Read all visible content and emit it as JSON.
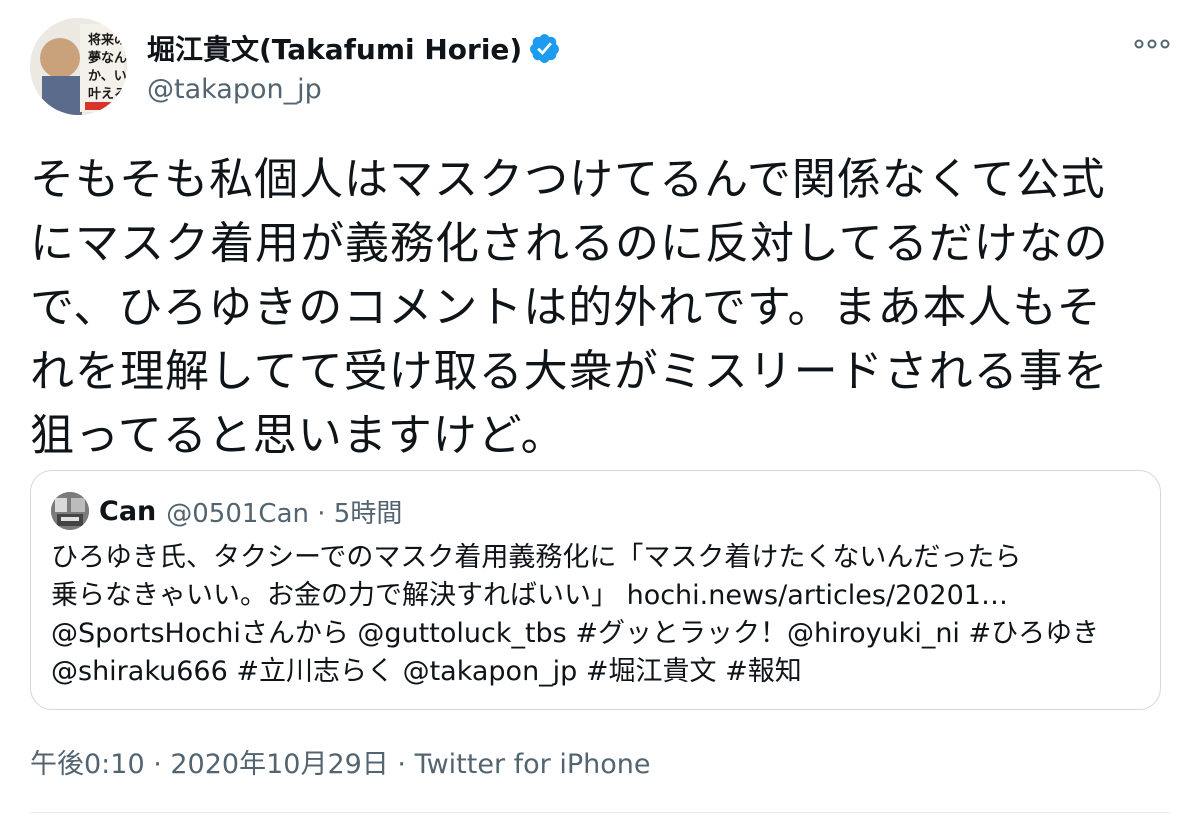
{
  "author": {
    "display_name": "堀江貴文(Takafumi Horie)",
    "handle": "@takapon_jp",
    "verified": true,
    "avatar_icon": "avatar-book-cover-icon",
    "avatar_text": "将来の夢なんか、いま叶えろ"
  },
  "menu": {
    "icon": "more-horizontal-icon"
  },
  "tweet": {
    "lines": [
      "そもそも私個人はマスクつけてるんで関係なくて公式",
      "にマスク着用が義務化されるのに反対してるだけなの",
      "で、ひろゆきのコメントは的外れです。まあ本人もそ",
      "れを理解してて受け取る大衆がミスリードされる事を",
      "狙ってると思いますけど。"
    ]
  },
  "quoted": {
    "name": "Can",
    "meta": "@0501Can · 5時間",
    "lines": [
      "ひろゆき氏、タクシーでのマスク着用義務化に「マスク着けたくないんだったら",
      "乗らなきゃいい。お金の力で解決すればいい」 hochi.news/articles/20201…",
      "@SportsHochiさんから @guttoluck_tbs #グッとラック！@hiroyuki_ni #ひろゆき",
      "@shiraku666 #立川志らく @takapon_jp #堀江貴文 #報知"
    ]
  },
  "footer": {
    "timestamp": "午後0:10 · 2020年10月29日 · ",
    "source": "Twitter for iPhone"
  },
  "colors": {
    "verified": "#1d9bf0",
    "secondary_text": "#536471",
    "border": "#cfd9de"
  }
}
